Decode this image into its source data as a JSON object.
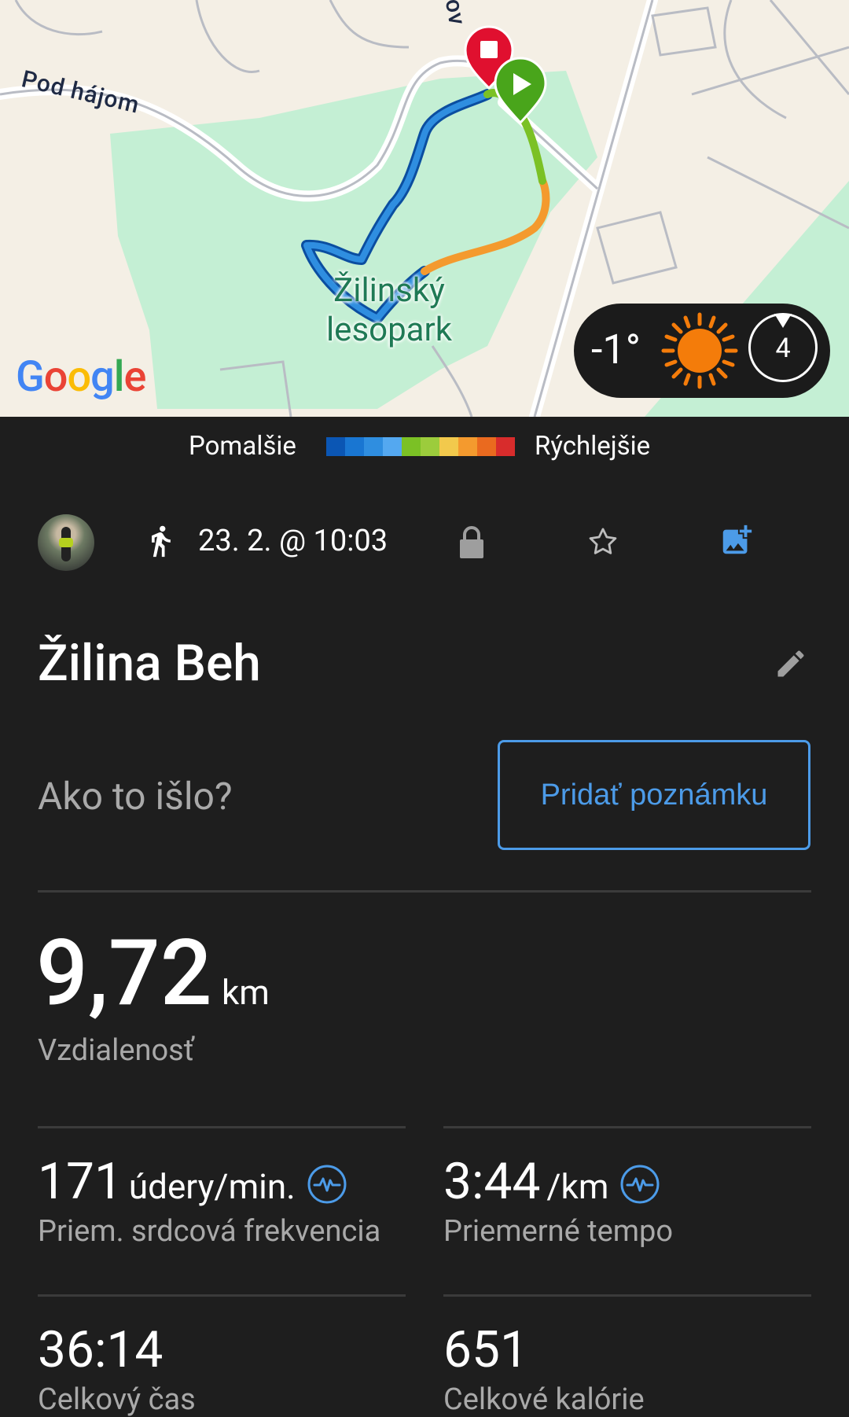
{
  "map": {
    "road_label_1": "Pod hájom",
    "road_label_2": "ov",
    "park_label": "Žilinský lesopark",
    "google_logo": "Google",
    "weather": {
      "temperature": "-1°",
      "condition_icon": "sun-icon",
      "wind_speed": "4"
    }
  },
  "legend": {
    "slow_label": "Pomalšie",
    "fast_label": "Rýchlejšie",
    "colors": [
      "#0b56b4",
      "#1976d2",
      "#2f8ee0",
      "#54a8f0",
      "#7bc125",
      "#9ccc3c",
      "#f2c94c",
      "#f49a2e",
      "#ea6a1f",
      "#d82c2c"
    ]
  },
  "activity": {
    "icon": "running-icon",
    "datetime": "23. 2. @ 10:03",
    "title": "Žilina Beh",
    "prompt": "Ako to išlo?",
    "add_note_label": "Pridať poznámku"
  },
  "distance": {
    "value": "9,72",
    "unit": "km",
    "label": "Vzdialenosť"
  },
  "stats": {
    "heart_rate": {
      "value": "171",
      "unit": "údery/min.",
      "label": "Priem. srdcová frekvencia"
    },
    "pace": {
      "value": "3:44",
      "unit": "/km",
      "label": "Priemerné tempo"
    },
    "time": {
      "value": "36:14",
      "label": "Celkový čas"
    },
    "calories": {
      "value": "651",
      "label": "Celkové kalórie"
    }
  },
  "colors": {
    "accent": "#4c9be8",
    "background": "#1e1e1e",
    "muted_text": "#a9a9a9"
  }
}
